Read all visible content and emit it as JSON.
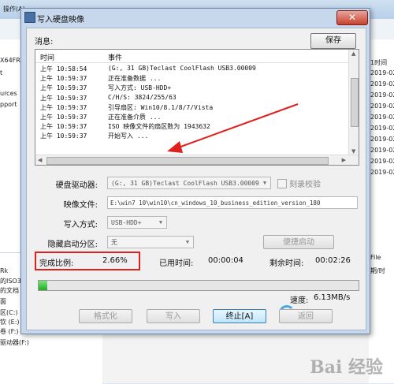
{
  "background": {
    "menu_fragment": "操作(A)",
    "left_texts": [
      "X64FRE",
      "t",
      "urces",
      "pport"
    ],
    "right_header": "1时间",
    "right_dates": [
      "2019-02",
      "2019-02",
      "2019-02",
      "2019-02",
      "2019-02",
      "2019-02",
      "2019-02",
      "2019-02",
      "2019-02",
      "2019-02"
    ],
    "lower_left_texts": [
      "Rk",
      "的ISO3",
      "的文档",
      "面",
      "区(C:)",
      "钦 (E:)",
      "卷 (F:)",
      "驱动器(F:)"
    ],
    "right_lower_texts": [
      "File",
      "期/时"
    ],
    "watermark": "Bai 经验"
  },
  "dialog": {
    "title": "写入硬盘映像",
    "close_label": "✕"
  },
  "messages": {
    "label": "消息:",
    "save_label": "保存",
    "col_time": "时间",
    "col_event": "事件",
    "rows": [
      {
        "time": "上午 10:58:54",
        "event": "(G:, 31 GB)Teclast CoolFlash USB3.00009"
      },
      {
        "time": "上午 10:59:37",
        "event": "正在准备数据 ..."
      },
      {
        "time": "上午 10:59:37",
        "event": "写入方式: USB-HDD+"
      },
      {
        "time": "上午 10:59:37",
        "event": "C/H/S: 3824/255/63"
      },
      {
        "time": "上午 10:59:37",
        "event": "引导扇区: Win10/8.1/8/7/Vista"
      },
      {
        "time": "上午 10:59:37",
        "event": "正在准备介质 ..."
      },
      {
        "time": "上午 10:59:37",
        "event": "ISO 映像文件的扇区数为 1943632"
      },
      {
        "time": "上午 10:59:37",
        "event": "开始写入 ..."
      }
    ]
  },
  "form": {
    "drive_label": "硬盘驱动器:",
    "drive_value": "(G:, 31 GB)Teclast CoolFlash USB3.00009",
    "verify_label": "刻录校验",
    "image_label": "映像文件:",
    "image_value": "E:\\win7 10\\win10\\cn_windows_10_business_edition_version_180",
    "method_label": "写入方式:",
    "method_value": "USB-HDD+",
    "hidden_label": "隐藏启动分区:",
    "hidden_value": "无",
    "convenient_boot_label": "便捷启动"
  },
  "status": {
    "percent_label": "完成比例:",
    "percent_value": "2.66%",
    "elapsed_label": "已用时间:",
    "elapsed_value": "00:00:04",
    "remaining_label": "剩余时间:",
    "remaining_value": "00:02:26",
    "progress_fraction": 0.0266,
    "speed_label": "速度:",
    "speed_value": "6.13MB/s"
  },
  "buttons": {
    "format": "格式化",
    "write": "写入",
    "abort": "终止[A]",
    "back": "返回"
  },
  "colors": {
    "highlight_box": "#e0201c",
    "annotation_arrow": "#e0201c",
    "progress_fill": "#1fae1f"
  }
}
